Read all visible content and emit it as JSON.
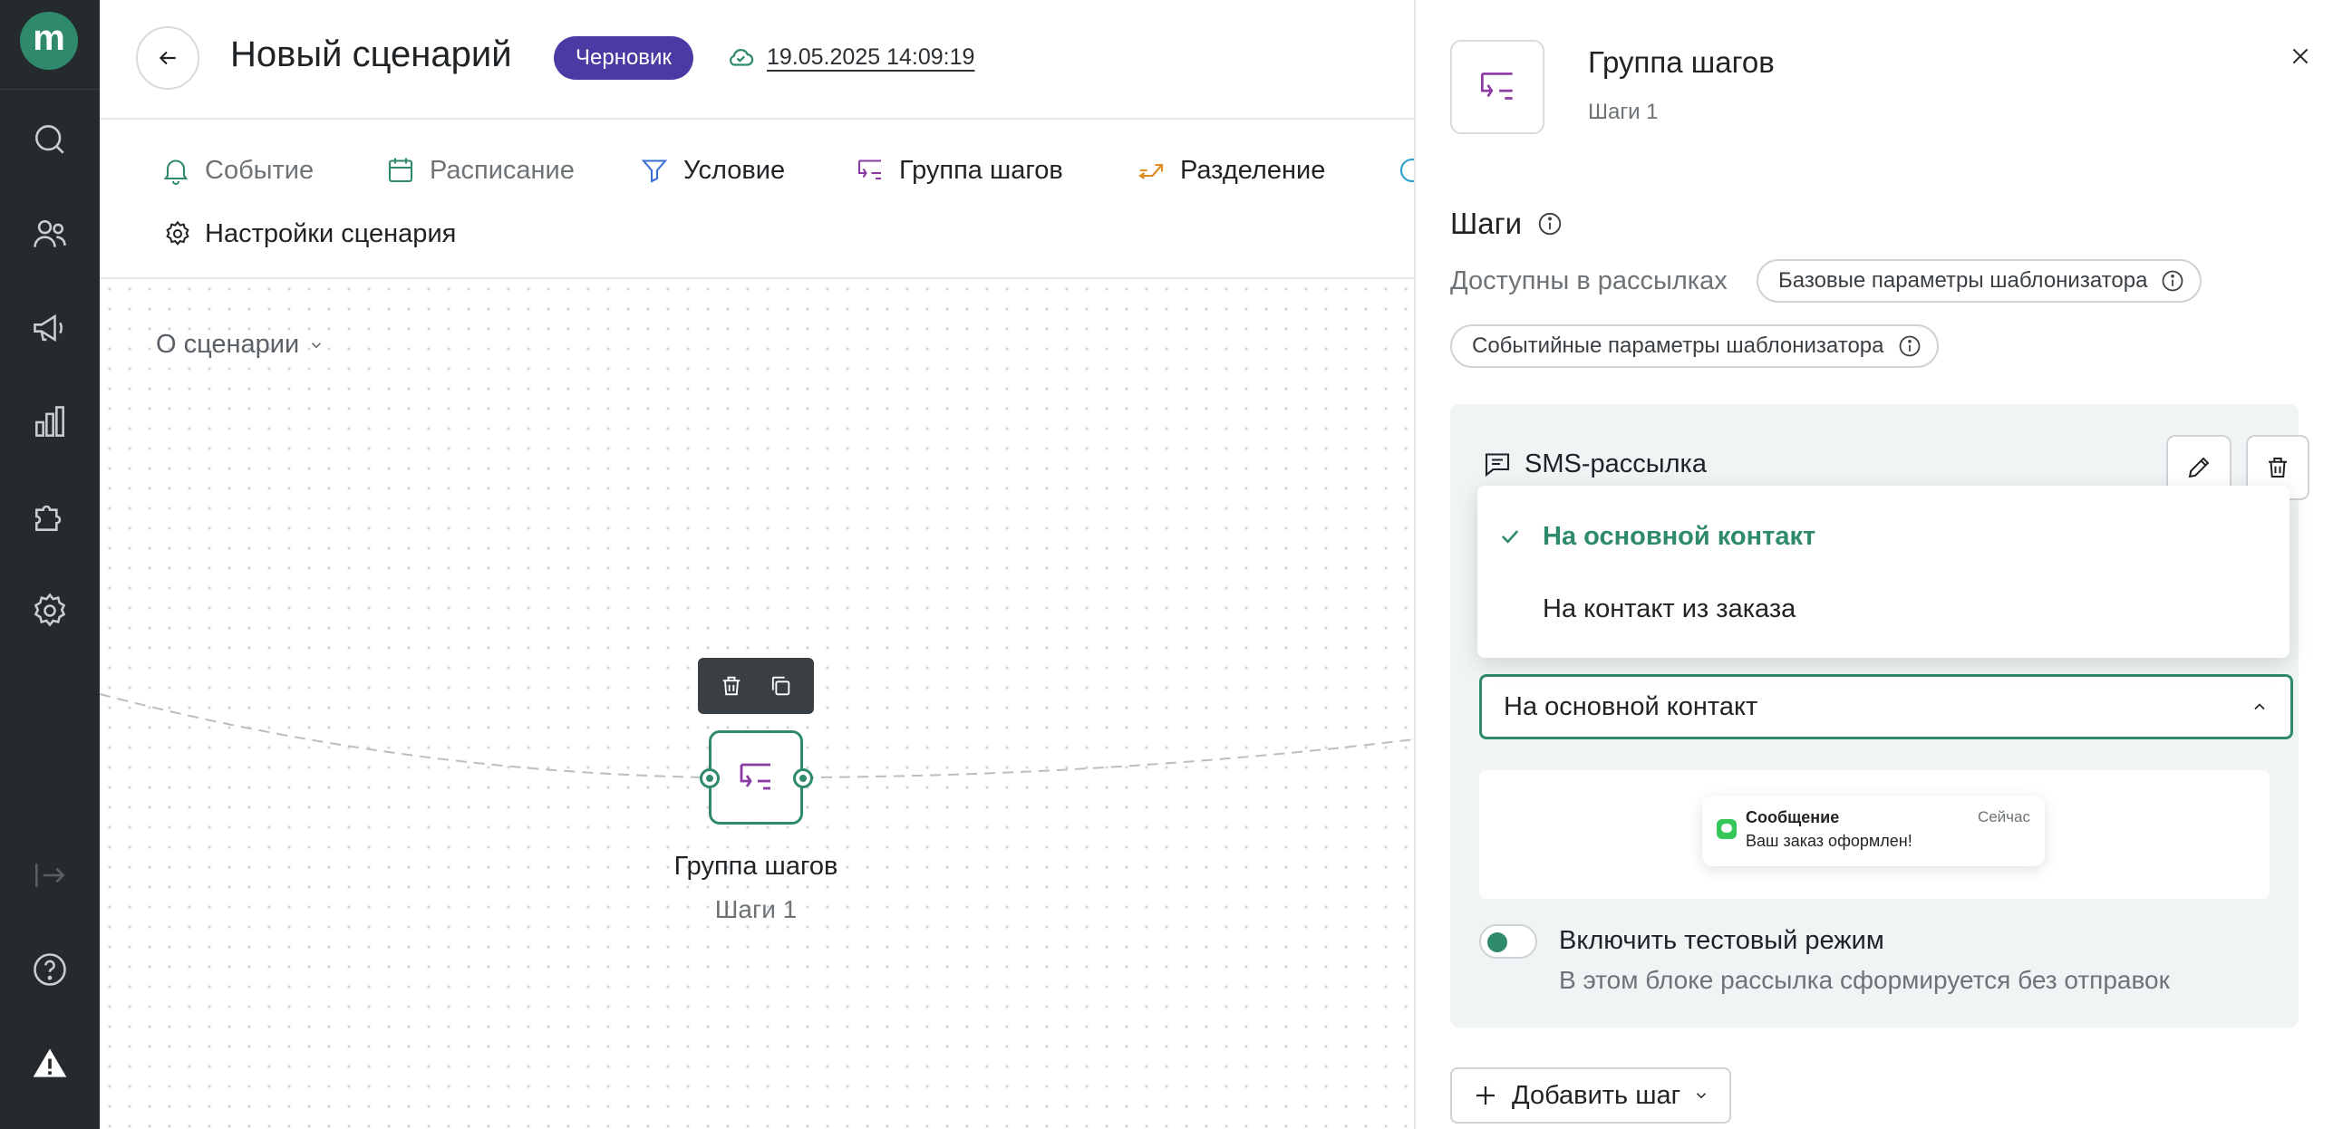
{
  "app": {
    "logo_letter": "m",
    "accent": "#2e8a6a",
    "brand_purple": "#4b3aa3",
    "rail_bg": "#252a2e"
  },
  "rail": {
    "items": [
      {
        "icon": "search-icon"
      },
      {
        "icon": "users-icon"
      },
      {
        "icon": "megaphone-icon"
      },
      {
        "icon": "chart-icon"
      },
      {
        "icon": "puzzle-icon"
      },
      {
        "icon": "gear-icon"
      },
      {
        "icon": "logout-icon"
      },
      {
        "icon": "help-icon"
      },
      {
        "icon": "warning-icon"
      }
    ]
  },
  "header": {
    "title": "Новый сценарий",
    "status_badge": "Черновик",
    "saved_timestamp": "19.05.2025 14:09:19"
  },
  "toolbar": {
    "items": [
      {
        "label": "Событие",
        "icon": "bell-icon"
      },
      {
        "label": "Расписание",
        "icon": "calendar-icon"
      },
      {
        "label": "Условие",
        "icon": "filter-icon"
      },
      {
        "label": "Группа шагов",
        "icon": "step-group-icon"
      },
      {
        "label": "Разделение",
        "icon": "split-icon"
      }
    ],
    "settings_label": "Настройки сценария"
  },
  "canvas": {
    "about_label": "О сценарии",
    "node": {
      "title": "Группа шагов",
      "subtitle": "Шаги 1"
    }
  },
  "panel": {
    "title": "Группа шагов",
    "subtitle": "Шаги 1",
    "steps_heading": "Шаги",
    "available_label": "Доступны в рассылках",
    "chips": [
      "Базовые параметры шаблонизатора",
      "Событийные параметры шаблонизатора"
    ],
    "step": {
      "title": "SMS-рассылка",
      "recipient_select": {
        "value": "На основной контакт",
        "options": [
          {
            "label": "На основной контакт",
            "selected": true
          },
          {
            "label": "На контакт из заказа",
            "selected": false
          }
        ]
      },
      "preview": {
        "title": "Сообщение",
        "time": "Сейчас",
        "text": "Ваш заказ оформлен!"
      },
      "test_mode": {
        "label": "Включить тестовый режим",
        "hint": "В этом блоке рассылка сформируется без отправок",
        "enabled": true
      }
    },
    "add_step_label": "Добавить шаг"
  }
}
